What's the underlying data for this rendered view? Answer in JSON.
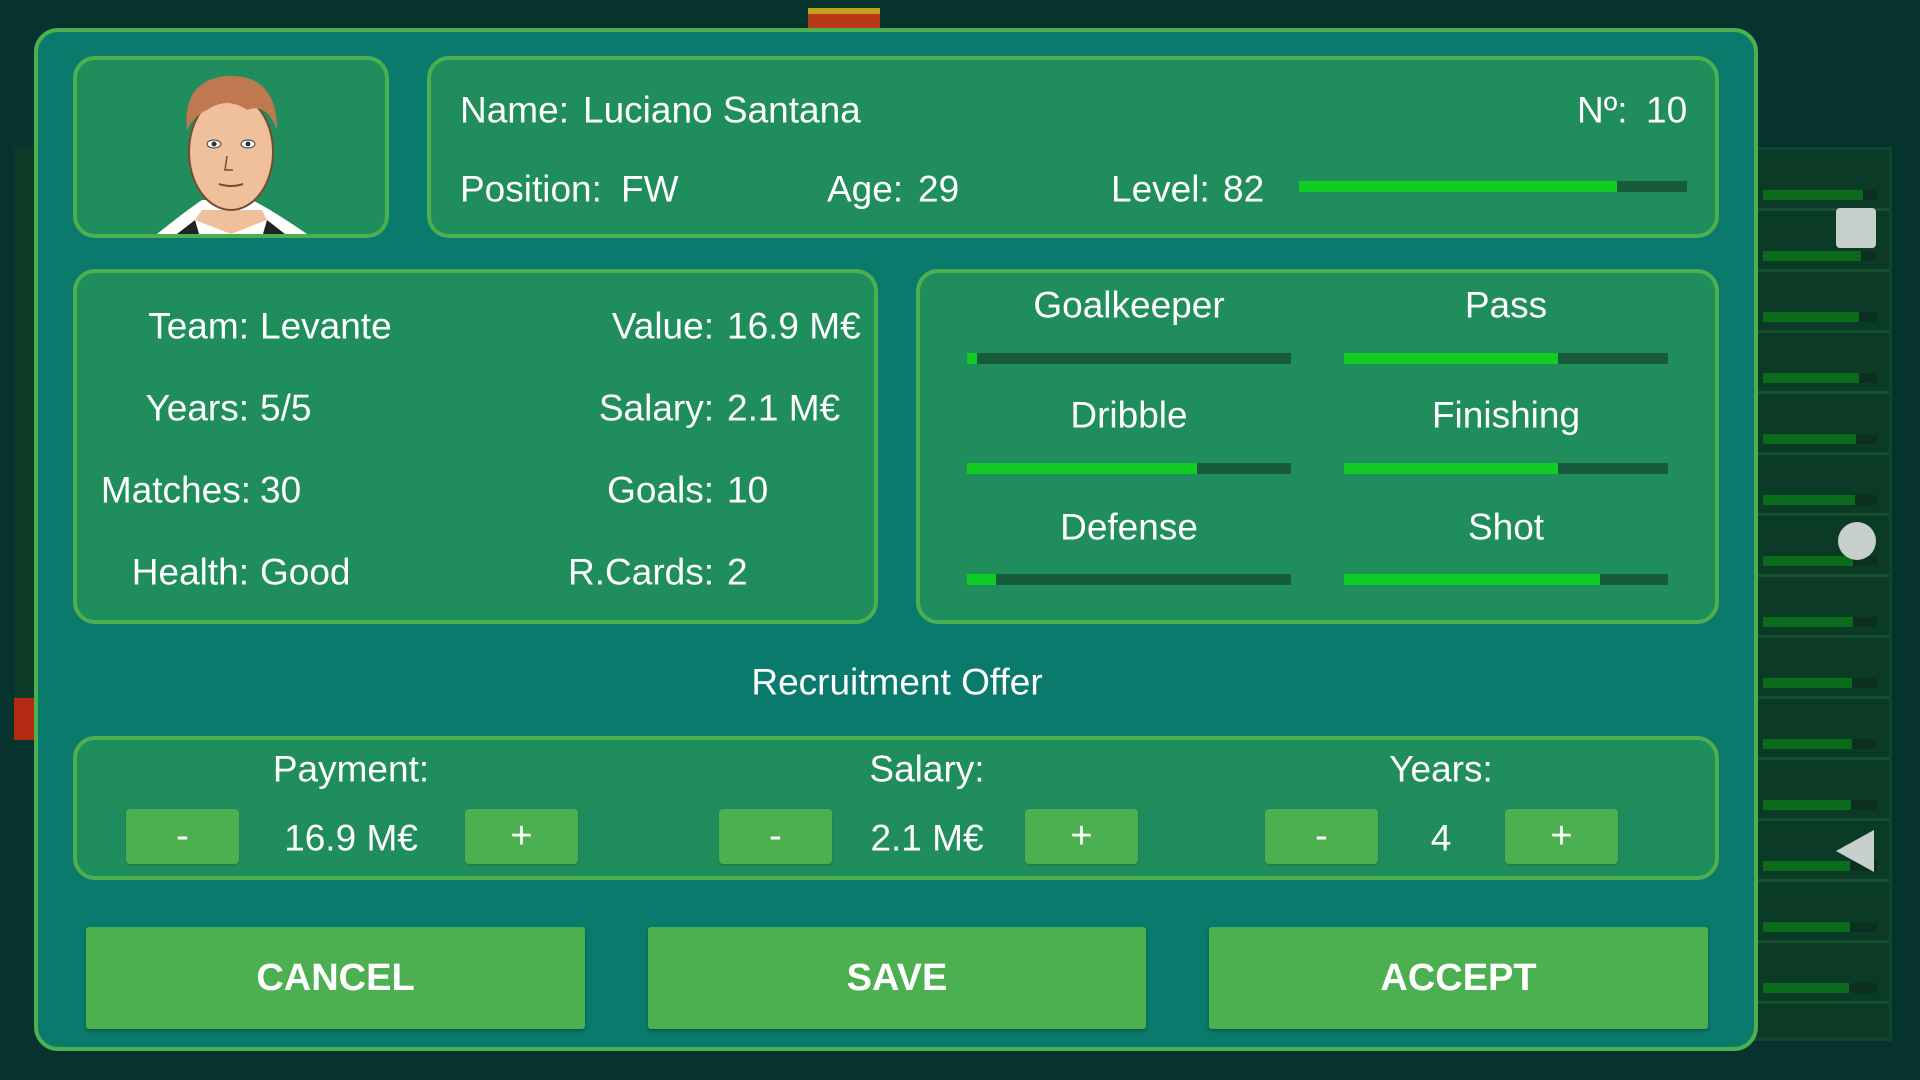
{
  "player": {
    "name_label": "Name:",
    "name": "Luciano Santana",
    "number_label": "Nº:",
    "number": "10",
    "position_label": "Position:",
    "position": "FW",
    "age_label": "Age:",
    "age": "29",
    "level_label": "Level:",
    "level": "82",
    "level_percent": 82
  },
  "stats": {
    "team_label": "Team:",
    "team": "Levante",
    "value_label": "Value:",
    "value": "16.9 M€",
    "years_label": "Years:",
    "years": "5/5",
    "salary_label": "Salary:",
    "salary": "2.1 M€",
    "matches_label": "Matches:",
    "matches": "30",
    "goals_label": "Goals:",
    "goals": "10",
    "health_label": "Health:",
    "health": "Good",
    "rcards_label": "R.Cards:",
    "rcards": "2"
  },
  "skills": [
    {
      "label": "Goalkeeper",
      "percent": 3
    },
    {
      "label": "Pass",
      "percent": 66
    },
    {
      "label": "Dribble",
      "percent": 71
    },
    {
      "label": "Finishing",
      "percent": 66
    },
    {
      "label": "Defense",
      "percent": 9
    },
    {
      "label": "Shot",
      "percent": 79
    }
  ],
  "offer": {
    "title": "Recruitment Offer",
    "payment_label": "Payment:",
    "payment": "16.9 M€",
    "salary_label": "Salary:",
    "salary": "2.1 M€",
    "years_label": "Years:",
    "years": "4",
    "minus": "-",
    "plus": "+"
  },
  "buttons": {
    "cancel": "CANCEL",
    "save": "SAVE",
    "accept": "ACCEPT"
  },
  "colors": {
    "accent": "#4caf50",
    "dialog": "#0a7a6c",
    "panel": "#1f8e5c",
    "bar_fill": "#11cc22",
    "bar_track": "#165b3c"
  }
}
